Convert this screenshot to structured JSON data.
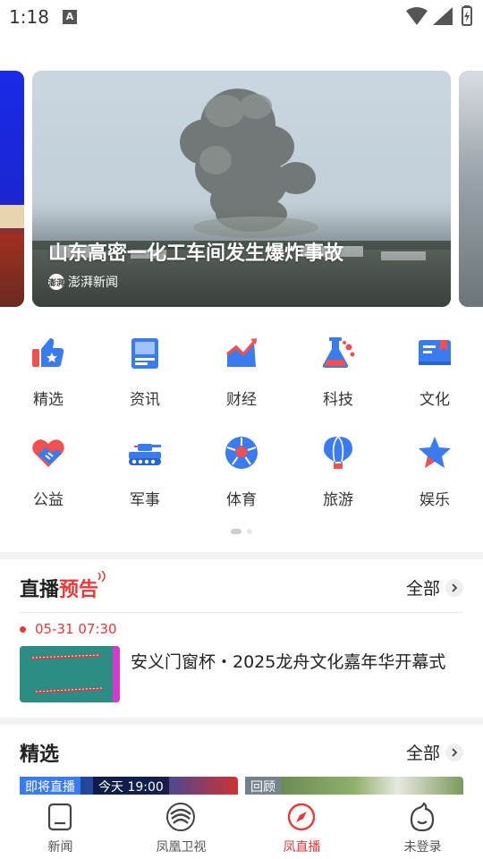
{
  "status_bar": {
    "time": "1:18",
    "notification_letter": "A"
  },
  "carousel": {
    "title": "山东高密一化工车间发生爆炸事故",
    "source": "澎湃新闻",
    "source_logo_text": "澎湃"
  },
  "categories": [
    {
      "label": "精选",
      "icon": "thumbs-up-star-icon"
    },
    {
      "label": "资讯",
      "icon": "news-document-icon"
    },
    {
      "label": "财经",
      "icon": "trend-chart-icon"
    },
    {
      "label": "科技",
      "icon": "flask-icon"
    },
    {
      "label": "文化",
      "icon": "book-icon"
    },
    {
      "label": "公益",
      "icon": "heart-handshake-icon"
    },
    {
      "label": "军事",
      "icon": "tank-icon"
    },
    {
      "label": "体育",
      "icon": "soccer-ball-icon"
    },
    {
      "label": "旅游",
      "icon": "hot-air-balloon-icon"
    },
    {
      "label": "娱乐",
      "icon": "star-icon"
    }
  ],
  "live_section": {
    "title_prefix": "直播",
    "title_highlight": "预告",
    "more_label": "全部",
    "item": {
      "time": "05-31 07:30",
      "title": "安义门窗杯・2025龙舟文化嘉年华开幕式"
    }
  },
  "featured_section": {
    "title": "精选",
    "more_label": "全部",
    "thumbs": [
      {
        "tag": "即将直播",
        "time": "今天 19:00"
      },
      {
        "tag": "回顾"
      }
    ]
  },
  "bottom_nav": [
    {
      "label": "新闻",
      "icon": "news-icon",
      "active": false
    },
    {
      "label": "凤凰卫视",
      "icon": "phoenix-tv-icon",
      "active": false
    },
    {
      "label": "凤直播",
      "icon": "compass-live-icon",
      "active": true
    },
    {
      "label": "未登录",
      "icon": "user-avatar-icon",
      "active": false
    }
  ],
  "colors": {
    "accent": "#e83a3a",
    "icon_blue": "#3a7bf0",
    "icon_red": "#f05050"
  }
}
